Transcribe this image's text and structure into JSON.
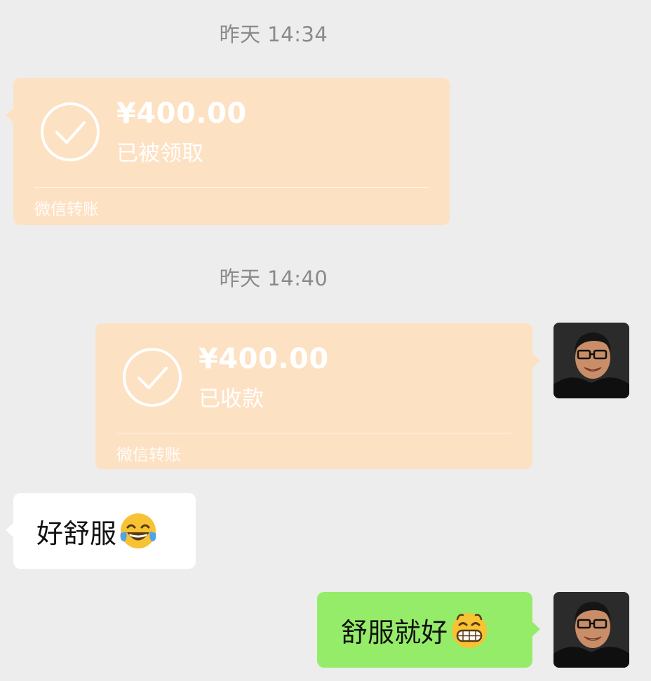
{
  "chat": {
    "messages": [
      {
        "timestamp": "昨天 14:34",
        "amount": "¥400.00",
        "status": "已被领取",
        "service": "微信转账"
      },
      {
        "timestamp": "昨天 14:40",
        "amount": "¥400.00",
        "status": "已收款",
        "service": "微信转账"
      },
      {
        "text": "好舒服",
        "emoji": "tears-of-joy-emoji"
      },
      {
        "text": "舒服就好",
        "emoji": "grinning-emoji"
      }
    ]
  },
  "colors": {
    "background": "#ededed",
    "transfer_bubble": "#fde1c3",
    "sent_bubble": "#95ec69",
    "received_bubble": "#ffffff",
    "timestamp_text": "#8a8a8a"
  }
}
